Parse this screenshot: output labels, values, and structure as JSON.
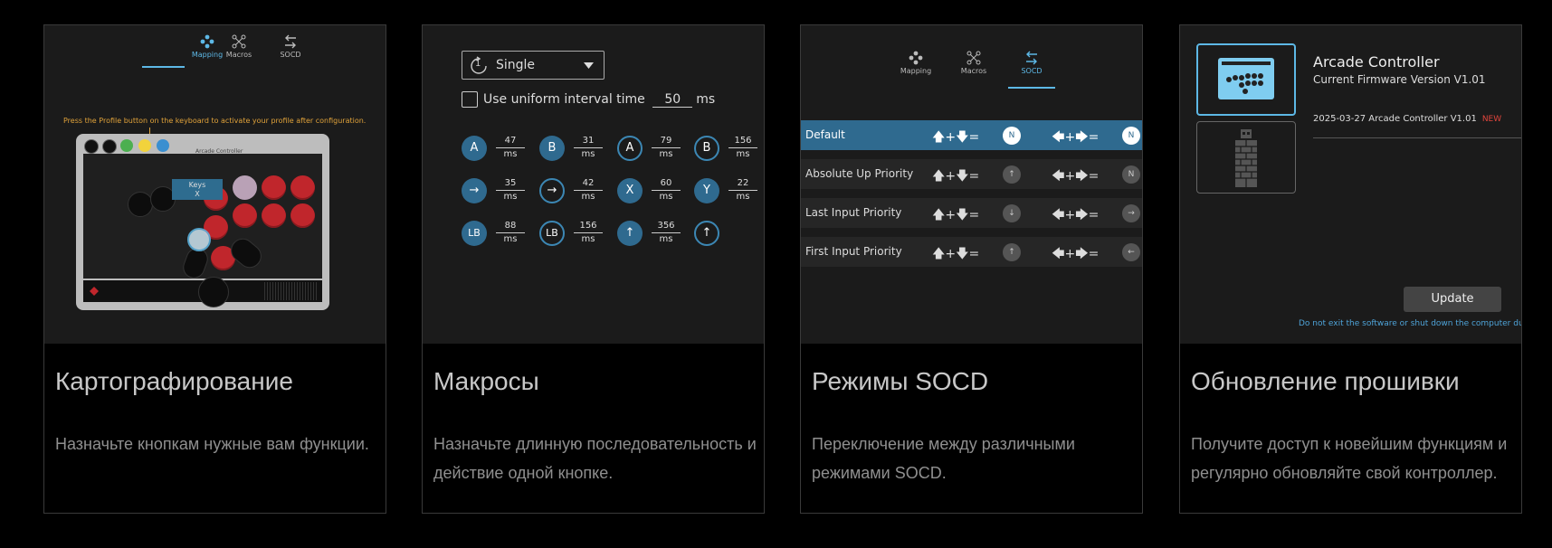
{
  "tabs": {
    "mapping": "Mapping",
    "macros": "Macros",
    "socd": "SOCD"
  },
  "mapping": {
    "hint": "Press the Profile button on the keyboard to activate your profile after configuration.",
    "board_title": "Arcade Controller",
    "keys_tooltip_line1": "Keys",
    "keys_tooltip_line2": "X"
  },
  "macros": {
    "mode_number": "1",
    "mode": "Single",
    "uniform_label": "Use uniform interval time",
    "interval": "50",
    "unit": "ms",
    "rows": [
      [
        {
          "key": "A",
          "value": "47",
          "style": "f"
        },
        {
          "key": "B",
          "value": "31",
          "style": "f"
        },
        {
          "key": "A",
          "value": "79",
          "style": "o"
        },
        {
          "key": "B",
          "value": "156",
          "style": "o"
        }
      ],
      [
        {
          "key": "→",
          "value": "35",
          "style": "f"
        },
        {
          "key": "→",
          "value": "42",
          "style": "o"
        },
        {
          "key": "X",
          "value": "60",
          "style": "f"
        },
        {
          "key": "Y",
          "value": "22",
          "style": "f"
        }
      ],
      [
        {
          "key": "LB",
          "value": "88",
          "style": "f"
        },
        {
          "key": "LB",
          "value": "156",
          "style": "o"
        },
        {
          "key": "↑",
          "value": "356",
          "style": "f"
        },
        {
          "key": "↑",
          "value": "",
          "style": "o"
        }
      ]
    ]
  },
  "socd": {
    "vertical_combo": "🡅+🡇=",
    "horizontal_combo": "🡄+🡆=",
    "rows": [
      {
        "label": "Default",
        "v": "N",
        "h": "N",
        "selected": true
      },
      {
        "label": "Absolute Up Priority",
        "v": "↑",
        "h": "N",
        "selected": false
      },
      {
        "label": "Last Input Priority",
        "v": "↓",
        "h": "→",
        "selected": false
      },
      {
        "label": "First Input Priority",
        "v": "↑",
        "h": "←",
        "selected": false
      }
    ]
  },
  "firmware": {
    "device": "Arcade Controller",
    "current_version": "Current Firmware Version V1.01",
    "release": "2025-03-27 Arcade Controller V1.01",
    "new_badge": "NEW",
    "update_label": "Update",
    "warning": "Do not exit the software or shut down the computer during"
  },
  "cards": [
    {
      "title": "Картографирование",
      "desc": "Назначьте кнопкам нужные вам функции."
    },
    {
      "title": "Макросы",
      "desc": "Назначьте длинную последовательность и действие одной кнопке."
    },
    {
      "title": "Режимы SOCD",
      "desc": "Переключение между различными режимами SOCD."
    },
    {
      "title": "Обновление прошивки",
      "desc": "Получите доступ к новейшим функциям и регулярно обновляйте свой контроллер."
    }
  ],
  "colors": {
    "accent": "#5db8e6",
    "button_blue": "#2f6a8f",
    "red_button": "#c0262c",
    "warning_orange": "#e0a23a"
  }
}
